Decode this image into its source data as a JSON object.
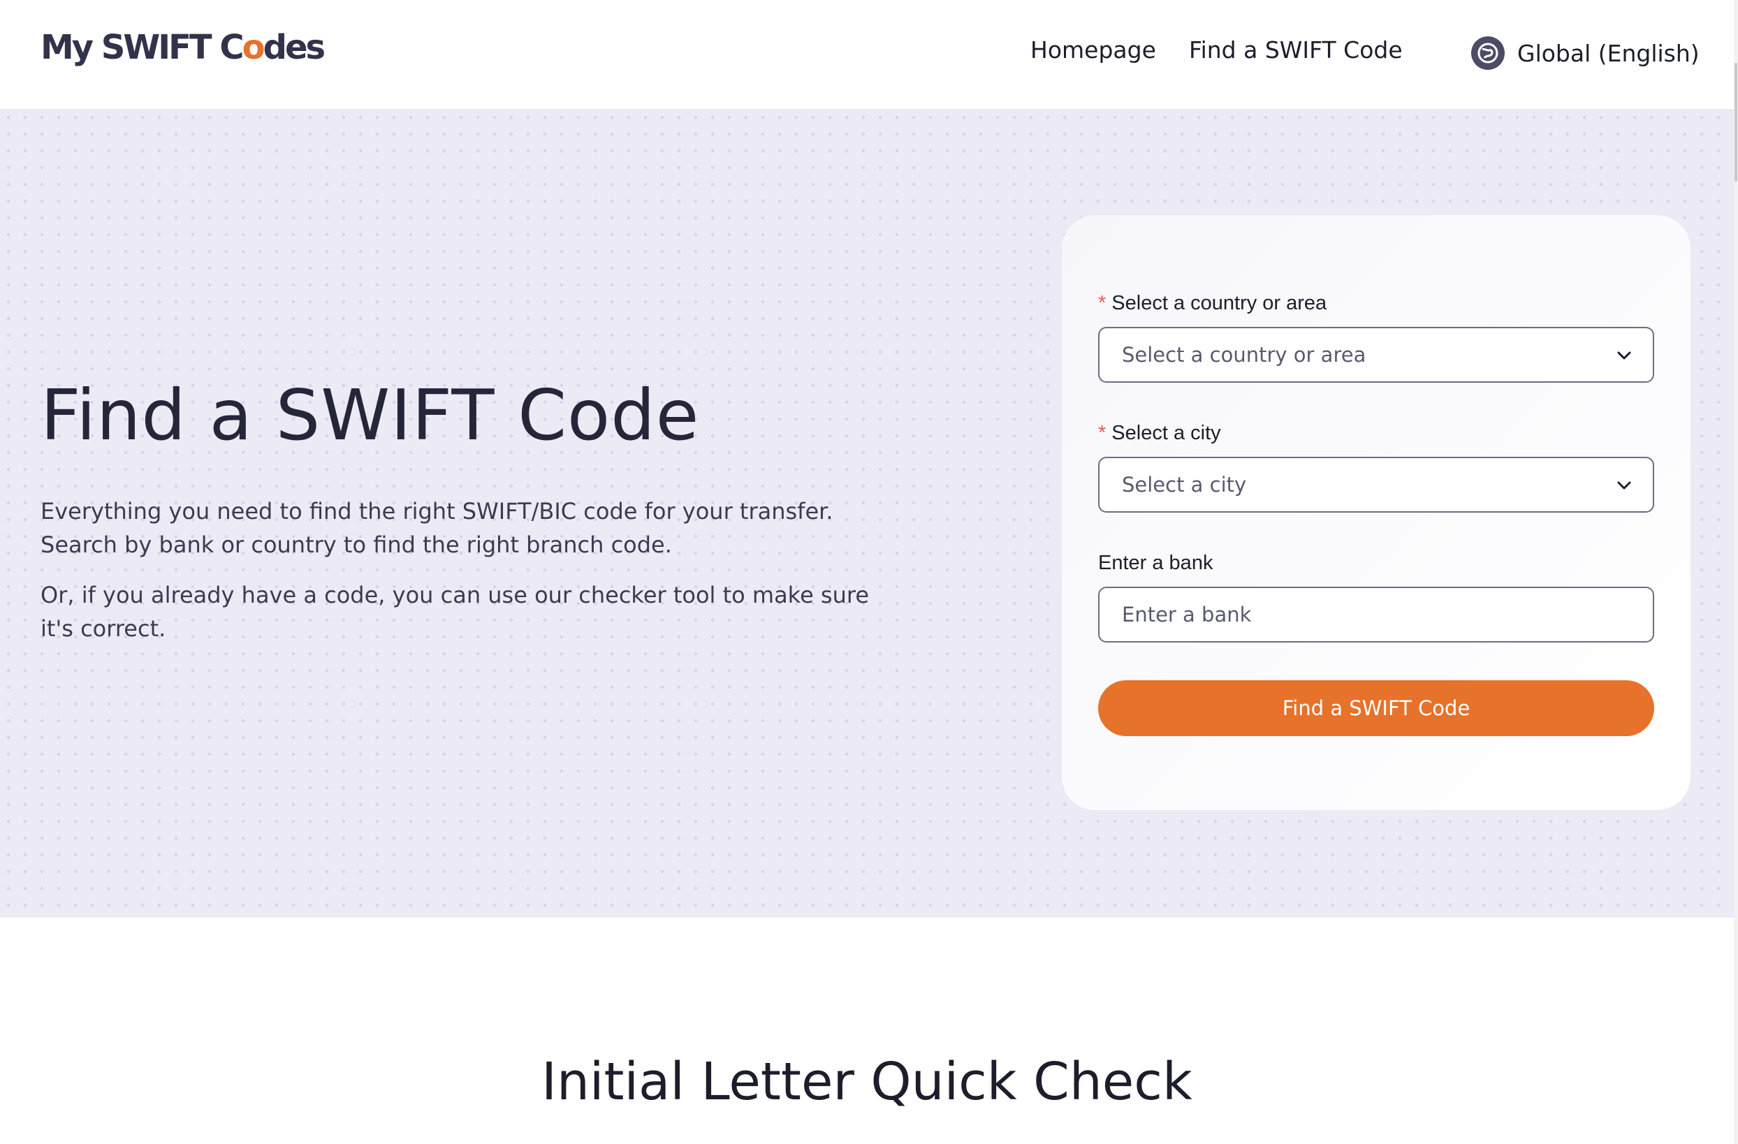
{
  "header": {
    "logo_prefix": "My SWIFT C",
    "logo_o": "o",
    "logo_suffix": "des",
    "nav": {
      "home": "Homepage",
      "find": "Find a SWIFT Code"
    },
    "language": "Global (English)"
  },
  "hero": {
    "title": "Find a SWIFT Code",
    "paragraph1": "Everything you need to find the right SWIFT/BIC code for your transfer. Search by bank or country to find the right branch code.",
    "paragraph2": "Or, if you already have a code, you can use our checker tool to make sure it's correct."
  },
  "form": {
    "required_mark": "*",
    "country": {
      "label": "Select a country or area",
      "placeholder": "Select a country or area"
    },
    "city": {
      "label": "Select a city",
      "placeholder": "Select a city"
    },
    "bank": {
      "label": "Enter a bank",
      "placeholder": "Enter a bank"
    },
    "submit_label": "Find a SWIFT Code"
  },
  "section2": {
    "title": "Initial Letter Quick Check"
  },
  "colors": {
    "accent": "#e6722c",
    "text": "#1d1d2b",
    "hero_bg": "#ecebf5"
  },
  "icons": {
    "language": "globe-icon",
    "dropdown": "chevron-down-icon"
  }
}
